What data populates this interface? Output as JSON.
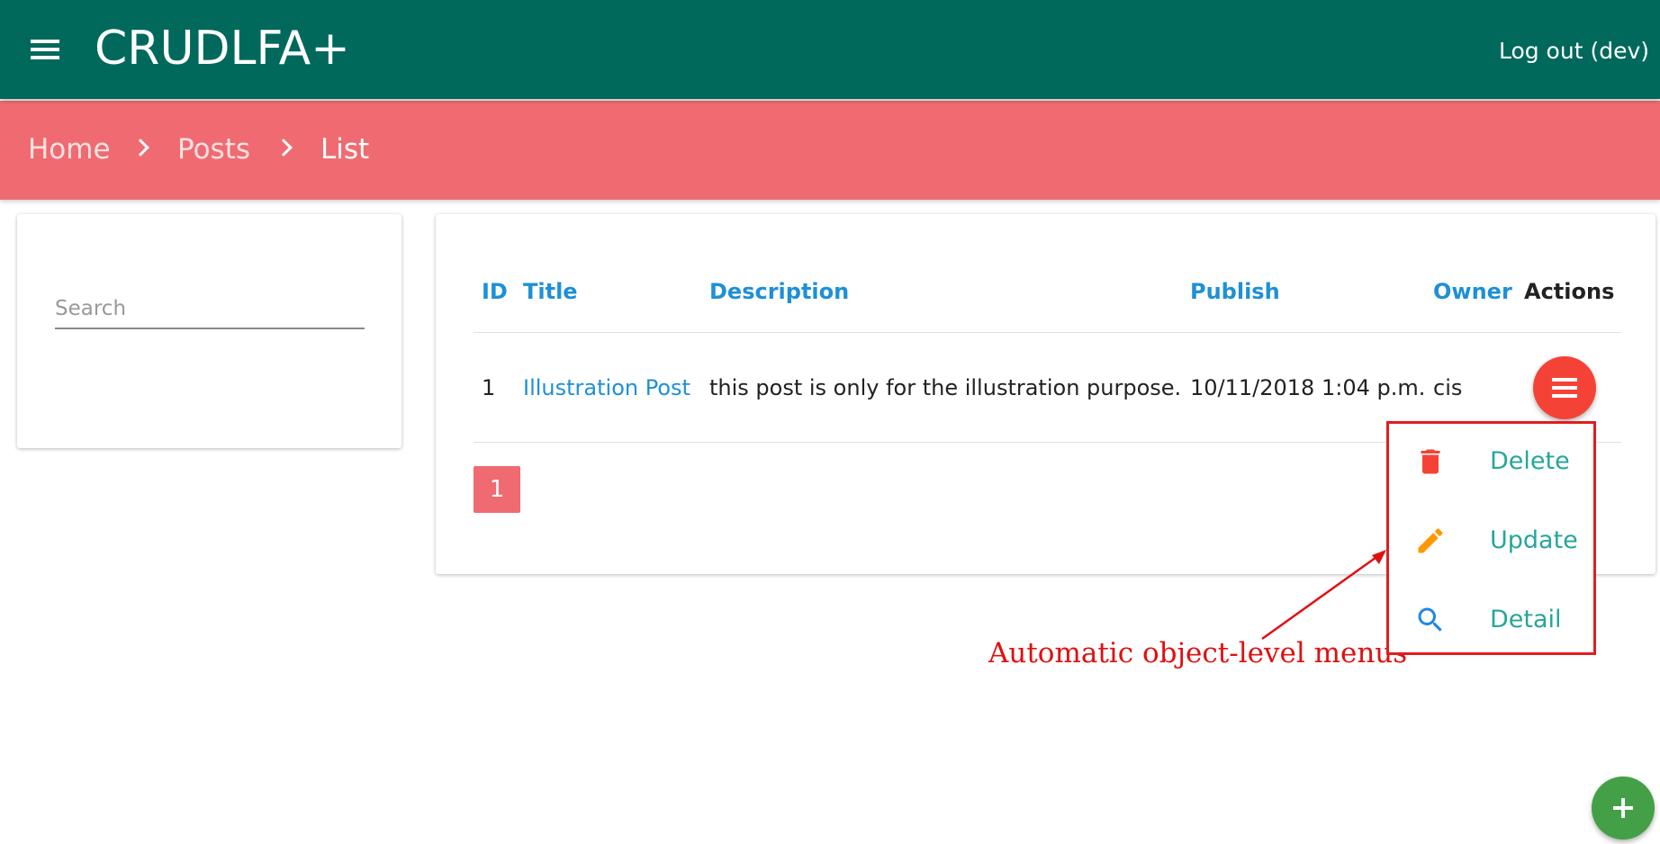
{
  "header": {
    "app_title": "CRUDLFA+",
    "menu_icon": "hamburger-menu-icon",
    "logout_label": "Log out (dev)"
  },
  "breadcrumb": {
    "items": [
      "Home",
      "Posts",
      "List"
    ],
    "separator_icon": "chevron-right-icon"
  },
  "search": {
    "placeholder": "Search",
    "value": ""
  },
  "table": {
    "columns": [
      "ID",
      "Title",
      "Description",
      "Publish",
      "Owner",
      "Actions"
    ],
    "rows": [
      {
        "id": "1",
        "title": "Illustration Post",
        "description": "this post is only for the illustration purpose.",
        "publish": "10/11/2018 1:04 p.m.",
        "owner": "cis"
      }
    ]
  },
  "pagination": {
    "current_page": "1"
  },
  "actions_menu": {
    "trigger_icon": "menu-icon",
    "items": [
      {
        "label": "Delete",
        "icon": "trash-icon",
        "color": "#f44336"
      },
      {
        "label": "Update",
        "icon": "pencil-icon",
        "color": "#ff9800"
      },
      {
        "label": "Detail",
        "icon": "search-icon",
        "color": "#1e88e5"
      }
    ]
  },
  "annotation": {
    "text": "Automatic object-level menus"
  },
  "fab": {
    "icon": "plus-icon",
    "color": "#43a047"
  },
  "colors": {
    "topbar": "#00695c",
    "breadcrumb_bar": "#f06b71",
    "link": "#1e90d6",
    "menu_label": "#26a69a",
    "annotation": "#e01010"
  }
}
